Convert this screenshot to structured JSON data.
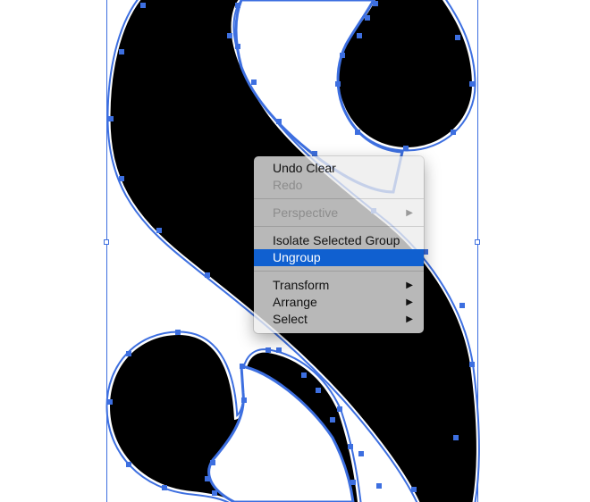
{
  "context_menu": {
    "items": [
      {
        "label": "Undo Clear",
        "enabled": true
      },
      {
        "label": "Redo",
        "enabled": false
      },
      {
        "label": "Perspective",
        "enabled": false,
        "submenu": true
      },
      {
        "label": "Isolate Selected Group",
        "enabled": true
      },
      {
        "label": "Ungroup",
        "enabled": true,
        "highlighted": true
      },
      {
        "label": "Transform",
        "enabled": true,
        "submenu": true
      },
      {
        "label": "Arrange",
        "enabled": true,
        "submenu": true
      },
      {
        "label": "Select",
        "enabled": true,
        "submenu": true
      }
    ],
    "submenu_arrow": "▶"
  },
  "artwork": {
    "fill_color": "#000000",
    "selection_color": "#3d6fe0",
    "outline_color": "#ffffff"
  }
}
